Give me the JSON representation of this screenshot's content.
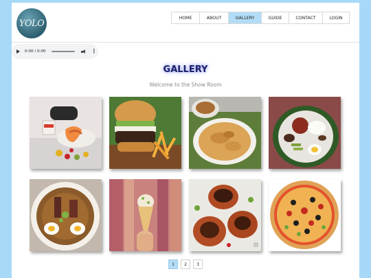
{
  "logo": {
    "text": "YOLO"
  },
  "nav": {
    "items": [
      {
        "label": "HOME",
        "active": false
      },
      {
        "label": "ABOUT",
        "active": false
      },
      {
        "label": "GALLERY",
        "active": true
      },
      {
        "label": "GUIDE",
        "active": false
      },
      {
        "label": "CONTACT",
        "active": false
      },
      {
        "label": "LOGIN",
        "active": false
      }
    ]
  },
  "audio": {
    "time": "0:00 / 0:00"
  },
  "gallery": {
    "title": "GALLERY",
    "subtitle": "Welcome to the Show Room",
    "images": [
      {
        "icon": "shrimp-dish-photo"
      },
      {
        "icon": "burger-fries-photo"
      },
      {
        "icon": "roti-curry-photo"
      },
      {
        "icon": "nasi-lemak-photo"
      },
      {
        "icon": "ramen-bowl-photo"
      },
      {
        "icon": "ice-cream-cone-photo"
      },
      {
        "icon": "grilled-chicken-photo"
      },
      {
        "icon": "pizza-photo"
      }
    ]
  },
  "pagination": {
    "pages": [
      "1",
      "2",
      "3"
    ],
    "current": "1"
  },
  "colors": {
    "background": "#a8d8f8",
    "active": "#b3ddf7",
    "title": "#1a1f66"
  }
}
